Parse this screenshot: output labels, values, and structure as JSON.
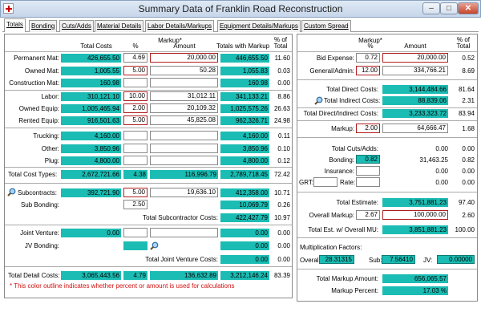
{
  "window": {
    "title": "Summary Data of Franklin Road Reconstruction",
    "minimize": "–",
    "maximize": "□",
    "close": "✕"
  },
  "tabs": [
    "Totals",
    "Bonding",
    "Cuts/Adds",
    "Material Details",
    "Labor Details/Markups",
    "Equipment Details/Markups",
    "Custom Spread"
  ],
  "left": {
    "headers": {
      "total_costs": "Total Costs",
      "markup": "Markup*",
      "pct": "%",
      "amount": "Amount",
      "totals_with_markup": "Totals with Markup",
      "pct_of_total_1": "% of",
      "pct_of_total_2": "Total"
    },
    "materials": [
      {
        "label": "Permanent Mat:",
        "total": "426,655.50",
        "pct": "4.69",
        "amount": "20,000.00",
        "with_markup": "446,655.50",
        "pct_total": "11.60"
      },
      {
        "label": "Owned Mat:",
        "total": "1,005.55",
        "pct": "5.00",
        "amount": "50.28",
        "with_markup": "1,055.83",
        "pct_total": "0.03"
      },
      {
        "label": "Construction Mat:",
        "total": "160.98",
        "pct": "",
        "amount": "",
        "with_markup": "160.98",
        "pct_total": "0.00"
      }
    ],
    "labor": [
      {
        "label": "Labor:",
        "total": "310,121.10",
        "pct": "10.00",
        "amount": "31,012.11",
        "with_markup": "341,133.21",
        "pct_total": "8.86"
      },
      {
        "label": "Owned Equip:",
        "total": "1,005,465.94",
        "pct": "2.00",
        "amount": "20,109.32",
        "with_markup": "1,025,575.26",
        "pct_total": "26.63"
      },
      {
        "label": "Rented Equip:",
        "total": "916,501.63",
        "pct": "5.00",
        "amount": "45,825.08",
        "with_markup": "962,326.71",
        "pct_total": "24.98"
      }
    ],
    "other": [
      {
        "label": "Trucking:",
        "total": "4,160.00",
        "pct": "",
        "amount": "",
        "with_markup": "4,160.00",
        "pct_total": "0.11"
      },
      {
        "label": "Other:",
        "total": "3,850.96",
        "pct": "",
        "amount": "",
        "with_markup": "3,850.96",
        "pct_total": "0.10"
      },
      {
        "label": "Plug:",
        "total": "4,800.00",
        "pct": "",
        "amount": "",
        "with_markup": "4,800.00",
        "pct_total": "0.12"
      }
    ],
    "total_cost_types": {
      "label": "Total Cost Types:",
      "total": "2,672,721.66",
      "pct": "4.38",
      "amount": "116,996.79",
      "with_markup": "2,789,718.45",
      "pct_total": "72.42"
    },
    "subcontracts": {
      "label": "Subcontracts:",
      "total": "392,721.90",
      "pct": "5.00",
      "amount": "19,636.10",
      "with_markup": "412,358.00",
      "pct_total": "10.71"
    },
    "sub_bonding": {
      "label": "Sub Bonding:",
      "pct": "2.50",
      "with_markup": "10,069.79",
      "pct_total": "0.26"
    },
    "total_subcontractor": {
      "label": "Total Subcontractor Costs:",
      "value": "422,427.79",
      "pct_total": "10.97"
    },
    "joint_venture": {
      "label": "Joint Venture:",
      "total": "0.00",
      "with_markup": "0.00",
      "pct_total": "0.00"
    },
    "jv_bonding": {
      "label": "JV Bonding:",
      "with_markup": "0.00",
      "pct_total": "0.00"
    },
    "total_jv": {
      "label": "Total Joint Venture Costs:",
      "value": "0.00",
      "pct_total": "0.00"
    },
    "total_detail": {
      "label": "Total Detail Costs:",
      "total": "3,065,443.56",
      "pct": "4.79",
      "amount": "136,632.89",
      "with_markup": "3,212,146.24",
      "pct_total": "83.39"
    },
    "footnote": "* This color outline indicates whether percent or amount is used for calculations"
  },
  "right": {
    "headers": {
      "markup": "Markup*",
      "pct": "%",
      "amount": "Amount",
      "pct_of_total_1": "% of",
      "pct_of_total_2": "Total"
    },
    "bid_expense": {
      "label": "Bid Expense:",
      "pct": "0.72",
      "amount": "20,000.00",
      "pct_total": "0.52"
    },
    "general_admin": {
      "label": "General/Admin:",
      "pct": "12.00",
      "amount": "334,766.21",
      "pct_total": "8.69"
    },
    "total_direct": {
      "label": "Total Direct Costs:",
      "value": "3,144,484.66",
      "pct_total": "81.64"
    },
    "total_indirect": {
      "label": "Total Indirect Costs:",
      "value": "88,839.06",
      "pct_total": "2.31"
    },
    "total_direct_indirect": {
      "label": "Total Direct/Indirect Costs:",
      "value": "3,233,323.72",
      "pct_total": "83.94"
    },
    "markup": {
      "label": "Markup:",
      "pct": "2.00",
      "amount": "64,666.47",
      "pct_total": "1.68"
    },
    "total_cuts_adds": {
      "label": "Total Cuts/Adds:",
      "value": "0.00",
      "pct_total": "0.00"
    },
    "bonding": {
      "label": "Bonding:",
      "pct": "0.82",
      "value": "31,463.25",
      "pct_total": "0.82"
    },
    "insurance": {
      "label": "Insurance:",
      "value": "0.00",
      "pct_total": "0.00"
    },
    "grt": {
      "label": "GRT:",
      "rate_label": "Rate:",
      "value": "0.00",
      "pct_total": "0.00"
    },
    "total_estimate": {
      "label": "Total Estimate:",
      "value": "3,751,881.23",
      "pct_total": "97.40"
    },
    "overall_markup": {
      "label": "Overall Markup:",
      "pct": "2.67",
      "amount": "100,000.00",
      "pct_total": "2.60"
    },
    "total_est_mu": {
      "label": "Total Est. w/ Overall MU:",
      "value": "3,851,881.23",
      "pct_total": "100.00"
    },
    "multiplication": {
      "title": "Multiplication Factors:",
      "overall_label": "Overall:",
      "overall": "28.31315",
      "sub_label": "Sub:",
      "sub": "7.56410",
      "jv_label": "JV:",
      "jv": "0.00000"
    },
    "total_markup_amount": {
      "label": "Total Markup Amount:",
      "value": "656,065.57"
    },
    "markup_percent": {
      "label": "Markup Percent:",
      "value": "17.03 %"
    }
  }
}
